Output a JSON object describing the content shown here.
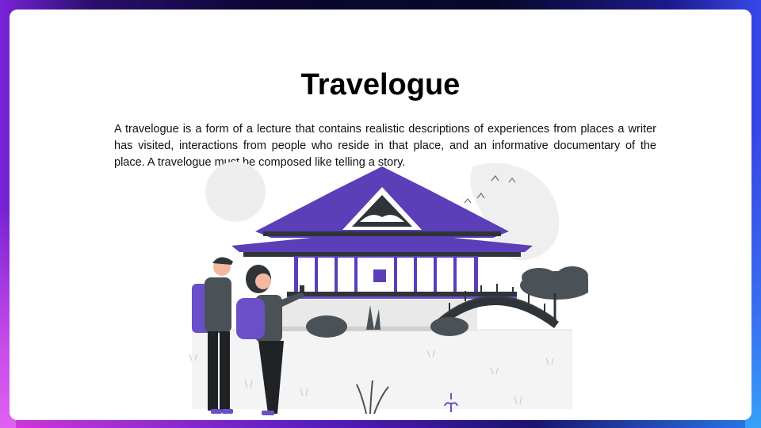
{
  "slide": {
    "title": "Travelogue",
    "description": "A travelogue is a form of a lecture that contains realistic descriptions of experiences from places a writer has visited, interactions from people who reside in that place, and an informative documentary of the place. A travelogue must be composed like telling a story."
  },
  "illustration": {
    "name": "travelers-at-pagoda",
    "colors": {
      "accent": "#6b4fc8",
      "dark": "#2f3438",
      "gray": "#e8e8e8",
      "roof": "#5a3fb8"
    }
  }
}
